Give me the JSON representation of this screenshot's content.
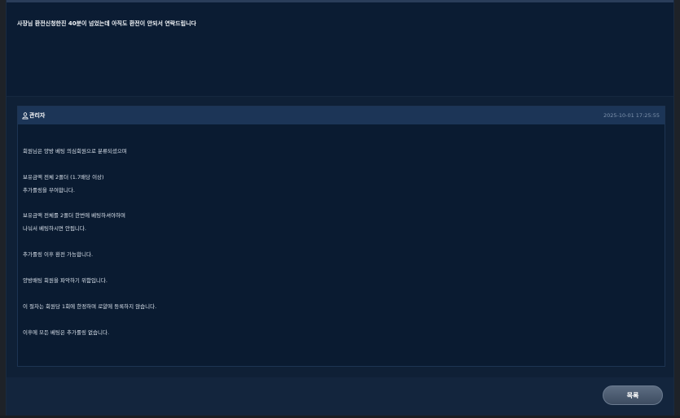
{
  "question": {
    "text": "사장님 환전신청한진 40분이 넘었는데 아직도 환전이 안되서 연락드립니다"
  },
  "answer": {
    "author": "관리자",
    "timestamp": "2025-10-01 17:25:55",
    "lines": [
      "회원님은 양방 베팅 의심회원으로 분류되셨으며",
      "보유금액 전체 2폴더 (1.7배당 이상)",
      "추가롤링을 부여합니다.",
      "보유금액 전체를 2폴더 한번에 베팅하셔야하며",
      "나눠서 베팅하시면 안됩니다.",
      "추가롤링 이후 환전 가능합니다.",
      "양방배팅 회원을 파악하기 위함입니다.",
      "이 절차는 회원당 1회에 한정하며 로얄에 등록하지 않습니다.",
      "이후에 모든 베팅은 추가롤링 없습니다."
    ]
  },
  "footer": {
    "list_button_label": "목록"
  },
  "colors": {
    "panel_bg": "#0b1c33",
    "header_bar": "#1c3557",
    "button": "#4e5d72"
  },
  "icons": {
    "author_icon": "person-icon"
  }
}
